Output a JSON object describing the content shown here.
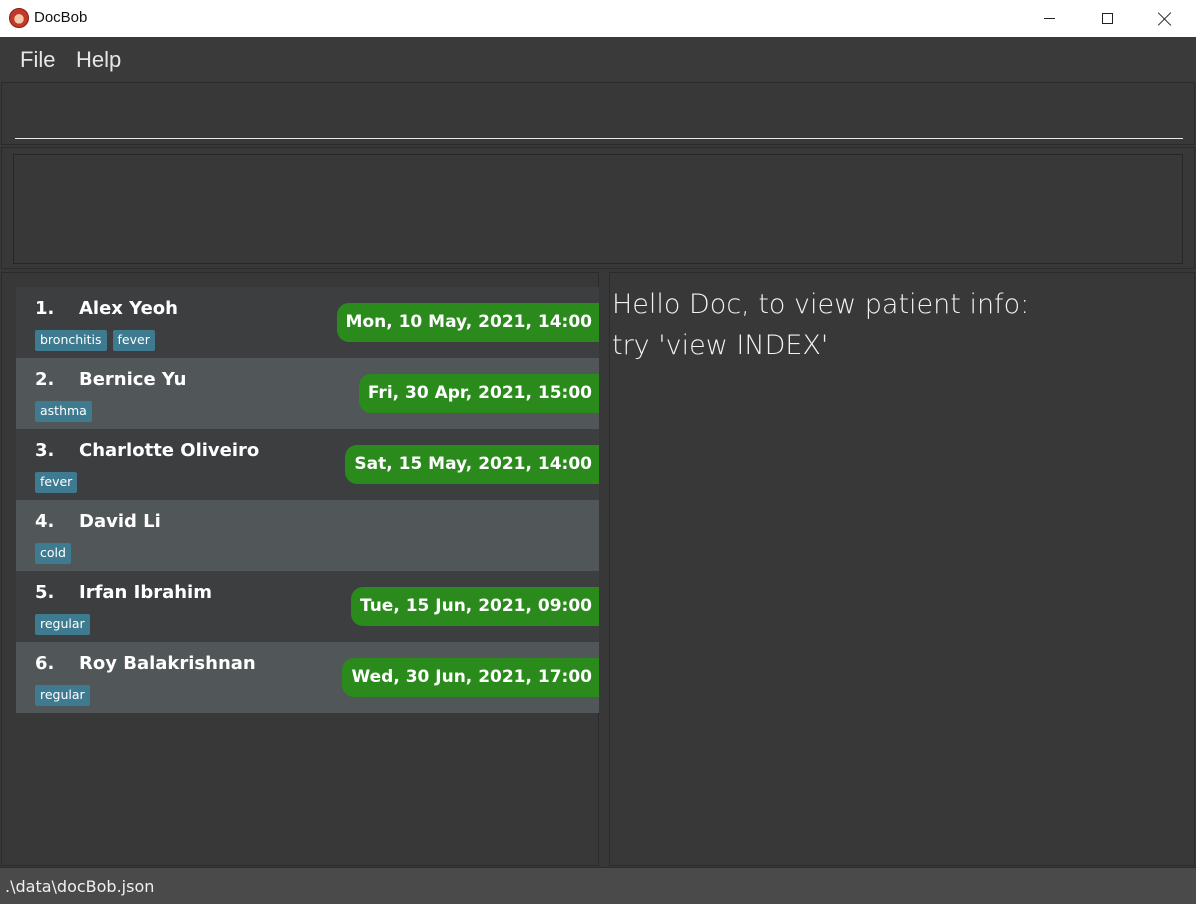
{
  "window": {
    "title": "DocBob",
    "controls": [
      "minimize-icon",
      "maximize-icon",
      "close-icon"
    ]
  },
  "menu": {
    "file_label": "File",
    "help_label": "Help"
  },
  "command": {
    "value": ""
  },
  "result": {
    "text": ""
  },
  "patients": [
    {
      "index": "1.",
      "name": "Alex Yeoh",
      "tags": [
        "bronchitis",
        "fever"
      ],
      "appointment": "Mon, 10 May, 2021, 14:00"
    },
    {
      "index": "2.",
      "name": "Bernice Yu",
      "tags": [
        "asthma"
      ],
      "appointment": "Fri, 30 Apr, 2021, 15:00"
    },
    {
      "index": "3.",
      "name": "Charlotte Oliveiro",
      "tags": [
        "fever"
      ],
      "appointment": "Sat, 15 May, 2021, 14:00"
    },
    {
      "index": "4.",
      "name": "David Li",
      "tags": [
        "cold"
      ],
      "appointment": ""
    },
    {
      "index": "5.",
      "name": "Irfan Ibrahim",
      "tags": [
        "regular"
      ],
      "appointment": "Tue, 15 Jun, 2021, 09:00"
    },
    {
      "index": "6.",
      "name": "Roy Balakrishnan",
      "tags": [
        "regular"
      ],
      "appointment": "Wed, 30 Jun, 2021, 17:00"
    }
  ],
  "info": {
    "line1": "Hello Doc, to view patient info:",
    "line2": "try 'view INDEX'"
  },
  "status": {
    "path": ".\\data\\docBob.json"
  },
  "colors": {
    "background": "#383838",
    "appointment_badge": "#2a8a1c",
    "tag": "#3e7b91",
    "row_alt": "#515658"
  }
}
